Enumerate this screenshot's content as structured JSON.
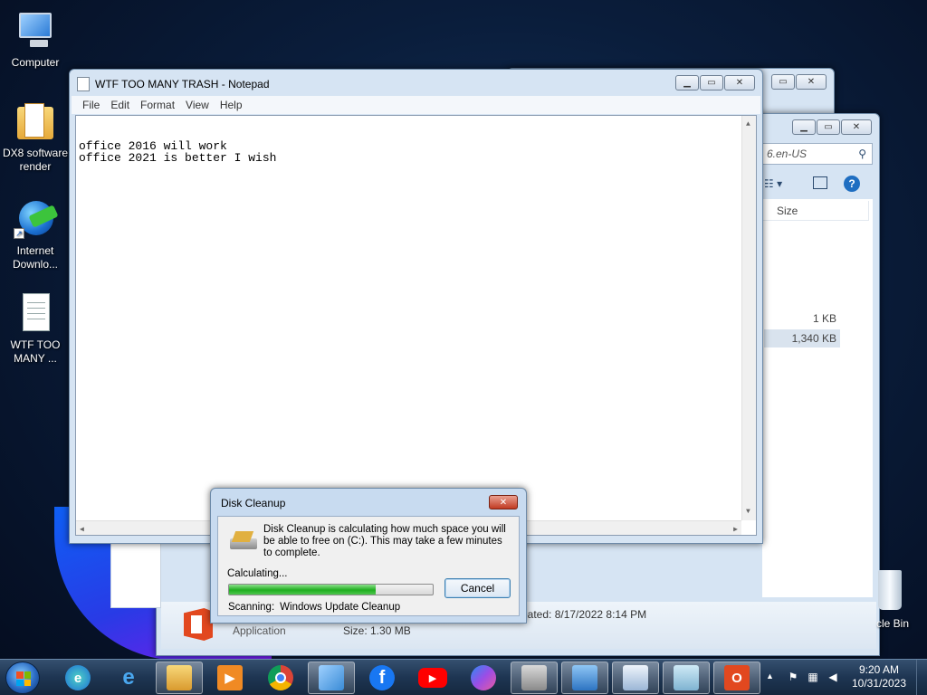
{
  "desktop": {
    "icons": [
      {
        "label": "Computer"
      },
      {
        "label": "DX8 software render"
      },
      {
        "label": "Internet Downlo..."
      },
      {
        "label": "WTF TOO MANY ..."
      }
    ],
    "recycle_bin_label": "cle Bin"
  },
  "notepad": {
    "title": "WTF TOO MANY TRASH - Notepad",
    "menu": [
      "File",
      "Edit",
      "Format",
      "View",
      "Help"
    ],
    "content": "office 2016 will work\noffice 2021 is better I wish"
  },
  "explorer": {
    "search_text": "6.en-US",
    "column_size": "Size",
    "sizes": [
      "1 KB",
      "1,340 KB"
    ],
    "details": {
      "type": "Application",
      "size": "Size: 1.30 MB",
      "created": "eated: 8/17/2022 8:14 PM"
    }
  },
  "disk_cleanup": {
    "title": "Disk Cleanup",
    "message": "Disk Cleanup is calculating how much space you will be able to free on  (C:). This may take a few minutes to complete.",
    "status": "Calculating...",
    "progress_percent": 72,
    "scanning_label": "Scanning:",
    "scanning_item": "Windows Update Cleanup",
    "cancel_label": "Cancel"
  },
  "taskbar": {
    "pinned": [
      "edge-icon",
      "internet-explorer-icon",
      "explorer-icon",
      "media-player-icon",
      "chrome-icon",
      "paint-icon",
      "facebook-icon",
      "youtube-icon",
      "copilot-icon",
      "disk-cleanup-icon",
      "control-panel-icon",
      "window-icon",
      "notepad-icon",
      "office-icon"
    ],
    "time": "9:20 AM",
    "date": "10/31/2023"
  },
  "colors": {
    "desktop_bg": "#0a1d3b",
    "taskbar": "#1e3552",
    "progress_fill": "#1fae1f",
    "office_red": "#e2481f"
  }
}
